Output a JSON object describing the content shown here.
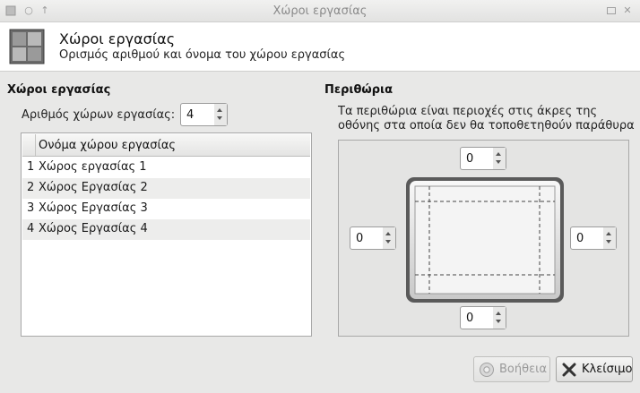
{
  "window": {
    "title": "Χώροι εργασίας"
  },
  "header": {
    "title": "Χώροι εργασίας",
    "subtitle": "Ορισμός αριθμού και όνομα του χώρου εργασίας"
  },
  "workspaces": {
    "section_title": "Χώροι εργασίας",
    "count_label": "Αριθμός χώρων εργασίας:",
    "count_value": "4",
    "column_header": "Ονόμα χώρου εργασίας",
    "rows": [
      {
        "num": "1",
        "name": "Χώρος εργασίας 1"
      },
      {
        "num": "2",
        "name": "Χώρος Εργασίας 2"
      },
      {
        "num": "3",
        "name": "Χώρος Εργασίας 3"
      },
      {
        "num": "4",
        "name": "Χώρος Εργασίας 4"
      }
    ]
  },
  "margins": {
    "section_title": "Περιθώρια",
    "description_line1": "Τα περιθώρια είναι περιοχές στις άκρες της",
    "description_line2": "οθόνης στα οποία δεν θα τοποθετηθούν παράθυρα",
    "top": "0",
    "left": "0",
    "right": "0",
    "bottom": "0"
  },
  "buttons": {
    "help": "Βοήθεια",
    "close": "Κλείσιμο"
  }
}
